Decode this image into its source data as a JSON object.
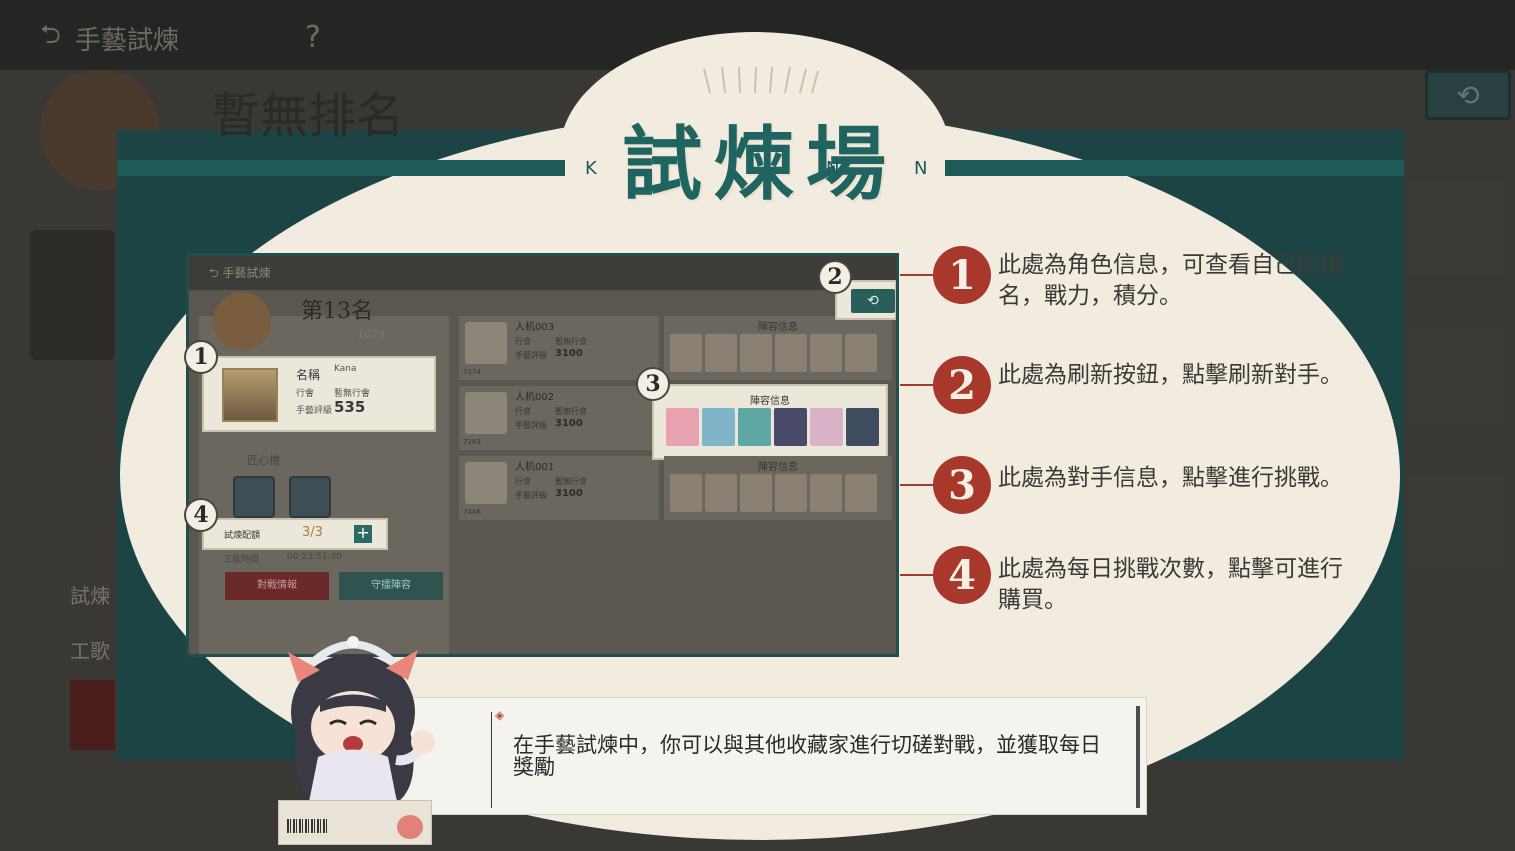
{
  "background": {
    "title": "手藝試煉",
    "help": "?",
    "rank_title": "暫無排名",
    "left_label_1": "試煉",
    "left_label_2": "工歌"
  },
  "tutorial": {
    "title": "試煉場",
    "title_letters": [
      "K",
      "N",
      "N"
    ],
    "items": [
      {
        "num": "1",
        "text": "此處為角色信息，可查看自己的排名，戰力，積分。"
      },
      {
        "num": "2",
        "text": "此處為刷新按鈕，點擊刷新對手。"
      },
      {
        "num": "3",
        "text": "此處為對手信息，點擊進行挑戰。"
      },
      {
        "num": "4",
        "text": "此處為每日挑戰次數，點擊可進行購買。"
      }
    ]
  },
  "mini": {
    "back": "手藝試煉",
    "rank": "第13名",
    "power": "1029",
    "player": {
      "name_label": "名稱",
      "name_value": "Kana",
      "guild_label": "行會",
      "guild_value": "暫無行會",
      "score_label": "手藝評級",
      "score_value": "535"
    },
    "craft_label": "匠心槽",
    "quota_label": "試煉配額",
    "quota_value": "3/3",
    "worktime_label": "工歌時間",
    "worktime_value": "00:23:51:40",
    "btn_battle": "對戰情報",
    "btn_defense": "守擂陣容",
    "opponents": [
      {
        "name": "人机003",
        "guild_label": "行會",
        "guild": "暫無行會",
        "score_label": "手藝評級",
        "score": "3100",
        "power": "7174"
      },
      {
        "name": "人机002",
        "guild_label": "行會",
        "guild": "暫無行會",
        "score_label": "手藝評級",
        "score": "3100",
        "power": "7263"
      },
      {
        "name": "人机001",
        "guild_label": "行會",
        "guild": "暫無行會",
        "score_label": "手藝評級",
        "score": "3100",
        "power": "7446"
      }
    ],
    "lineup_title": "陣容信息",
    "badges": [
      "1",
      "2",
      "3",
      "4"
    ]
  },
  "dialog": {
    "text": "在手藝試煉中，你可以與其他收藏家進行切磋對戰，並獲取每日獎勵"
  },
  "colors": {
    "accent_teal": "#1e5a58",
    "accent_red": "#a8372c",
    "panel_cream": "#f1ecdf"
  }
}
